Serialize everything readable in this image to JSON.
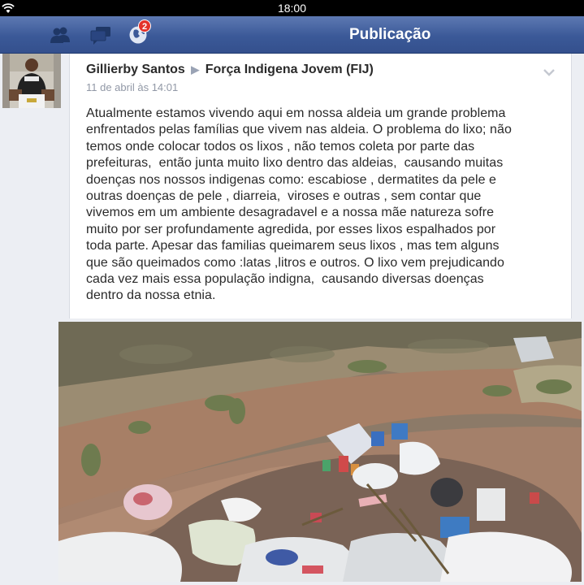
{
  "status_bar": {
    "time": "18:00",
    "wifi_icon": "wifi-icon"
  },
  "nav_bar": {
    "title": "Publicação",
    "icons": [
      "friend-requests-icon",
      "messages-icon",
      "notifications-globe-icon"
    ],
    "notification_count": "2",
    "color": "#3b5998"
  },
  "post": {
    "author": "Gillierby Santos",
    "separator": "▶",
    "group": "Força Indigena Jovem (FIJ)",
    "date": "11 de abril às 14:01",
    "text_lines": [
      "Atualmente estamos vivendo aqui em nossa aldeia um grande problema",
      "enfrentados pelas famílias que vivem nas aldeia. O problema do lixo; não",
      "temos onde colocar todos os lixos , não temos coleta por parte das",
      "prefeituras,  então junta muito lixo dentro das aldeias,  causando muitas",
      "doenças nos nossos indigenas como: escabiose , dermatites da pele e",
      "outras doenças de pele , diarreia,  viroses e outras , sem contar que",
      "vivemos em um ambiente desagradavel e a nossa mãe natureza sofre",
      "muito por ser profundamente agredida, por esses lixos espalhados por",
      "toda parte. Apesar das familias queimarem seus lixos , mas tem alguns",
      "que são queimados como :latas ,litros e outros. O lixo vem prejudicando",
      "cada vez mais essa população indigna,  causando diversas doenças",
      "dentro da nossa etnia."
    ]
  }
}
